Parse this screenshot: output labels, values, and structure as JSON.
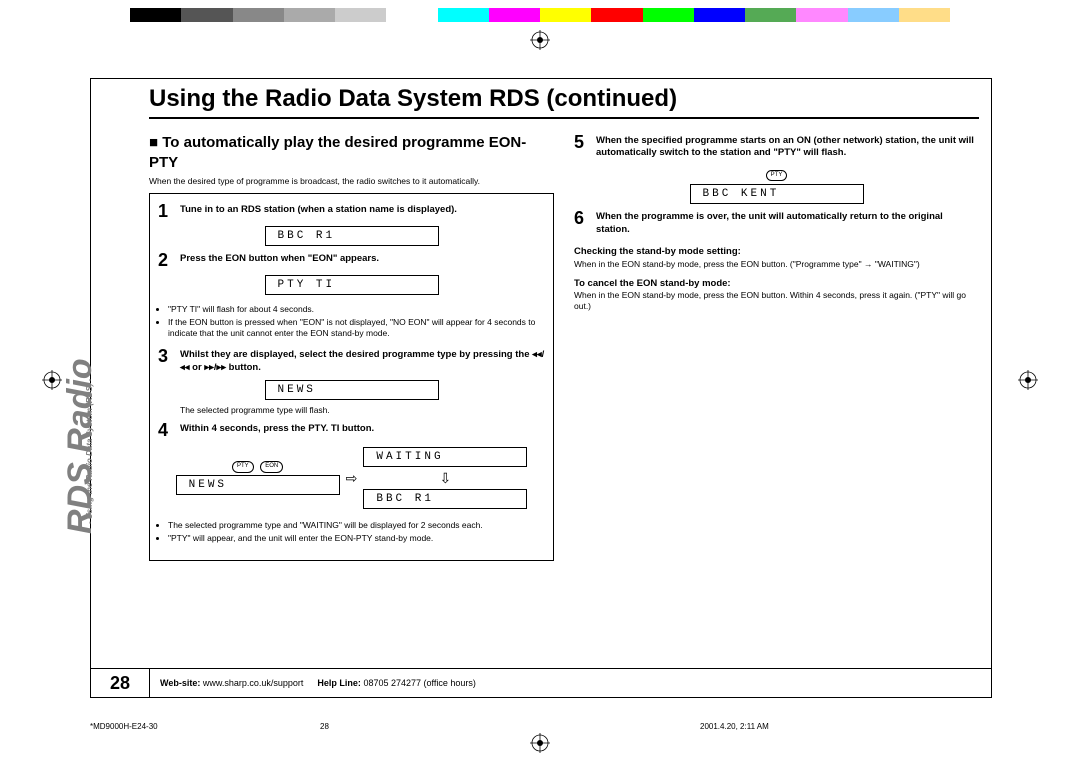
{
  "colorbar": [
    "#000",
    "#555",
    "#888",
    "#aaa",
    "#ccc",
    "#fff",
    "#0ff",
    "#f0f",
    "#ff0",
    "#f00",
    "#0f0",
    "#00f",
    "#5a5",
    "#f8f",
    "#8cf",
    "#fd8"
  ],
  "sidebar": {
    "big": "RDS Radio",
    "small": "- Using the Radio Data System (RDS) -"
  },
  "heading": "Using the Radio Data System RDS (continued)",
  "left": {
    "subheading_prefix": "■ ",
    "subheading": "To automatically play the desired programme EON-PTY",
    "intro": "When the desired type of programme is broadcast, the radio switches to it automatically.",
    "steps": [
      {
        "num": "1",
        "text": "Tune in to an RDS station (when a station name is displayed).",
        "lcds": [
          "BBC  R1"
        ]
      },
      {
        "num": "2",
        "text": "Press the EON button when \"EON\" appears.",
        "lcds": [
          "PTY  TI"
        ],
        "bullets": [
          "\"PTY TI\" will flash for about 4 seconds.",
          "If the EON button is pressed when \"EON\" is not displayed, \"NO EON\" will appear for 4 seconds to indicate that the unit cannot enter the EON stand-by mode."
        ]
      },
      {
        "num": "3",
        "text_prefix": "Whilst they are displayed, select the desired programme type by pressing the ",
        "text_suffix": " button.",
        "buttons": "◂◂/◂◂ or ▸▸/▸▸",
        "lcds": [
          "NEWS"
        ],
        "note": "The selected programme type will flash."
      },
      {
        "num": "4",
        "text": "Within 4 seconds, press the PTY. TI button.",
        "flow": {
          "top_left_btns": [
            "PTY",
            "EON"
          ],
          "left_lcd": "NEWS",
          "arrow_right": "⇨",
          "right_lcd_top": "WAITING",
          "arrow_down": "⇩",
          "right_lcd_bottom": "BBC  R1"
        },
        "bullets": [
          "The selected programme type and \"WAITING\" will be displayed for 2 seconds each.",
          "\"PTY\" will appear, and the unit will enter the EON-PTY stand-by mode."
        ]
      }
    ]
  },
  "right": {
    "steps": [
      {
        "num": "5",
        "text": "When the specified programme starts on an ON (other network) station, the unit will automatically switch to the station and \"PTY\" will flash.",
        "top_btn": "PTY",
        "lcd": "BBC  KENT"
      },
      {
        "num": "6",
        "text": "When the programme is over, the unit will automatically return to the original station."
      }
    ],
    "check_heading": "Checking the stand-by mode setting:",
    "check_text": "When in the EON stand-by mode, press the EON button. (\"Programme type\" → \"WAITING\")",
    "cancel_heading": "To cancel the EON stand-by mode:",
    "cancel_text": "When in the EON stand-by mode, press the EON button. Within 4 seconds, press it again. (\"PTY\" will go out.)"
  },
  "footer": {
    "page": "28",
    "website_label": "Web-site:",
    "website": "www.sharp.co.uk/support",
    "help_label": "Help Line:",
    "help": "08705 274277 (office hours)"
  },
  "printmeta": {
    "filename": "*MD9000H-E24-30",
    "pg": "28",
    "date": "2001.4.20, 2:11 AM"
  }
}
